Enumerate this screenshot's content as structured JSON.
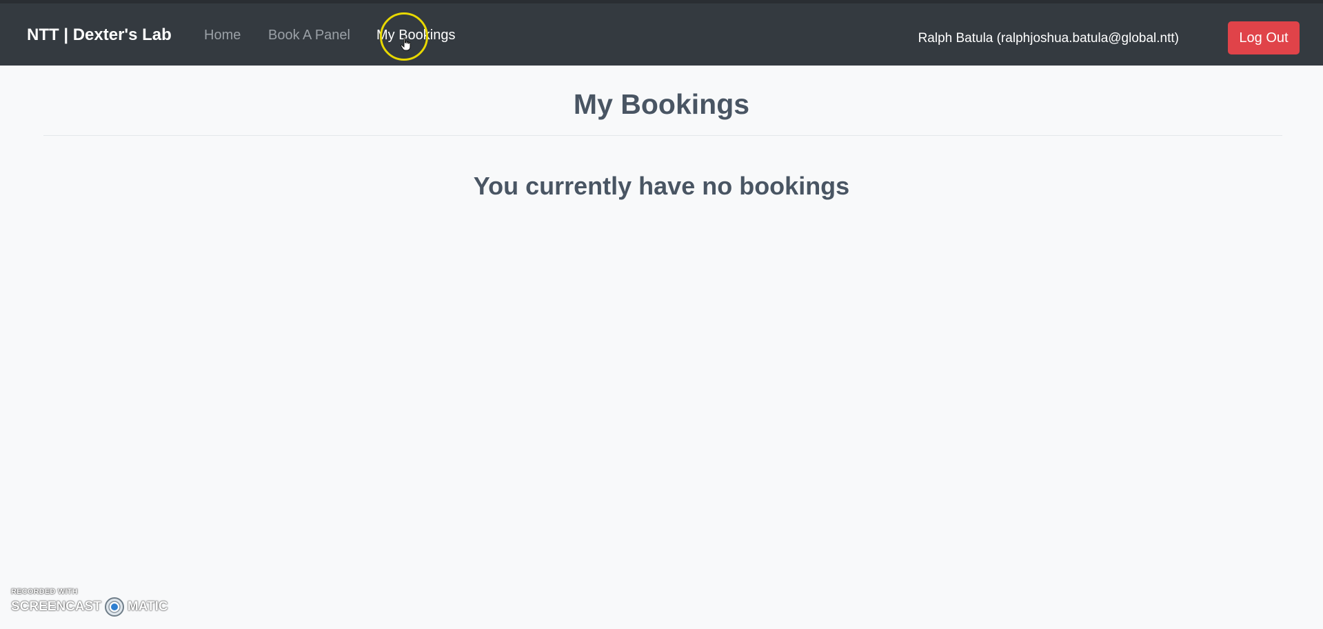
{
  "navbar": {
    "brand": "NTT | Dexter's Lab",
    "links": [
      {
        "label": "Home",
        "active": false
      },
      {
        "label": "Book A Panel",
        "active": false
      },
      {
        "label": "My Bookings",
        "active": true
      }
    ],
    "user": "Ralph Batula (ralphjoshua.batula@global.ntt)",
    "logout_label": "Log Out"
  },
  "main": {
    "title": "My Bookings",
    "empty_message": "You currently have no bookings"
  },
  "watermark": {
    "top": "RECORDED WITH",
    "left": "SCREENCAST",
    "right": "MATIC"
  },
  "colors": {
    "navbar": "#343a40",
    "logout": "#e04349",
    "heading": "#495563",
    "click_ring": "#e8d800"
  },
  "icons": [
    "hand-pointer-cursor-icon",
    "screencast-o-matic-logo-icon"
  ]
}
